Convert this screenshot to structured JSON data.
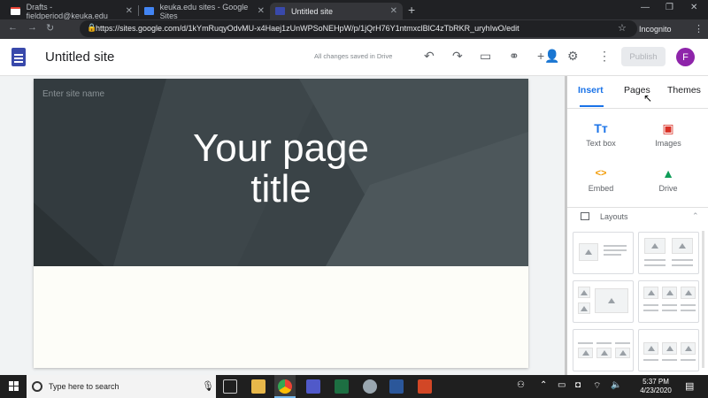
{
  "browser": {
    "tabs": [
      {
        "title": "Drafts - fieldperiod@keuka.edu",
        "icon": "gmail-icon"
      },
      {
        "title": "keuka.edu sites - Google Sites",
        "icon": "google-sites-icon"
      },
      {
        "title": "Untitled site",
        "icon": "google-sites-icon"
      }
    ],
    "url": "https://sites.google.com/d/1kYmRuqyOdvMU-x4Haej1zUnWPSoNEHpW/p/1jQrH76Y1ntmxclBlC4zTbRKR_uryhIwO/edit",
    "incognito_label": "Incognito"
  },
  "sites": {
    "doc_title": "Untitled site",
    "save_status": "All changes saved in Drive",
    "publish_label": "Publish",
    "avatar_letter": "F",
    "accent_color": "#1a73e8",
    "avatar_color": "#8e24aa"
  },
  "page": {
    "site_name_placeholder": "Enter site name",
    "title_line1": "Your page",
    "title_line2": "title"
  },
  "panel": {
    "tabs": [
      "Insert",
      "Pages",
      "Themes"
    ],
    "active_tab": "Insert",
    "insert_items": [
      {
        "label": "Text box",
        "icon": "text-box-icon",
        "glyph": "Tт"
      },
      {
        "label": "Images",
        "icon": "images-icon",
        "glyph": "▣"
      },
      {
        "label": "Embed",
        "icon": "embed-icon",
        "glyph": "<>"
      },
      {
        "label": "Drive",
        "icon": "drive-icon",
        "glyph": "▲"
      }
    ],
    "layouts_label": "Layouts"
  },
  "taskbar": {
    "search_placeholder": "Type here to search",
    "time": "5:37 PM",
    "date": "4/23/2020"
  }
}
